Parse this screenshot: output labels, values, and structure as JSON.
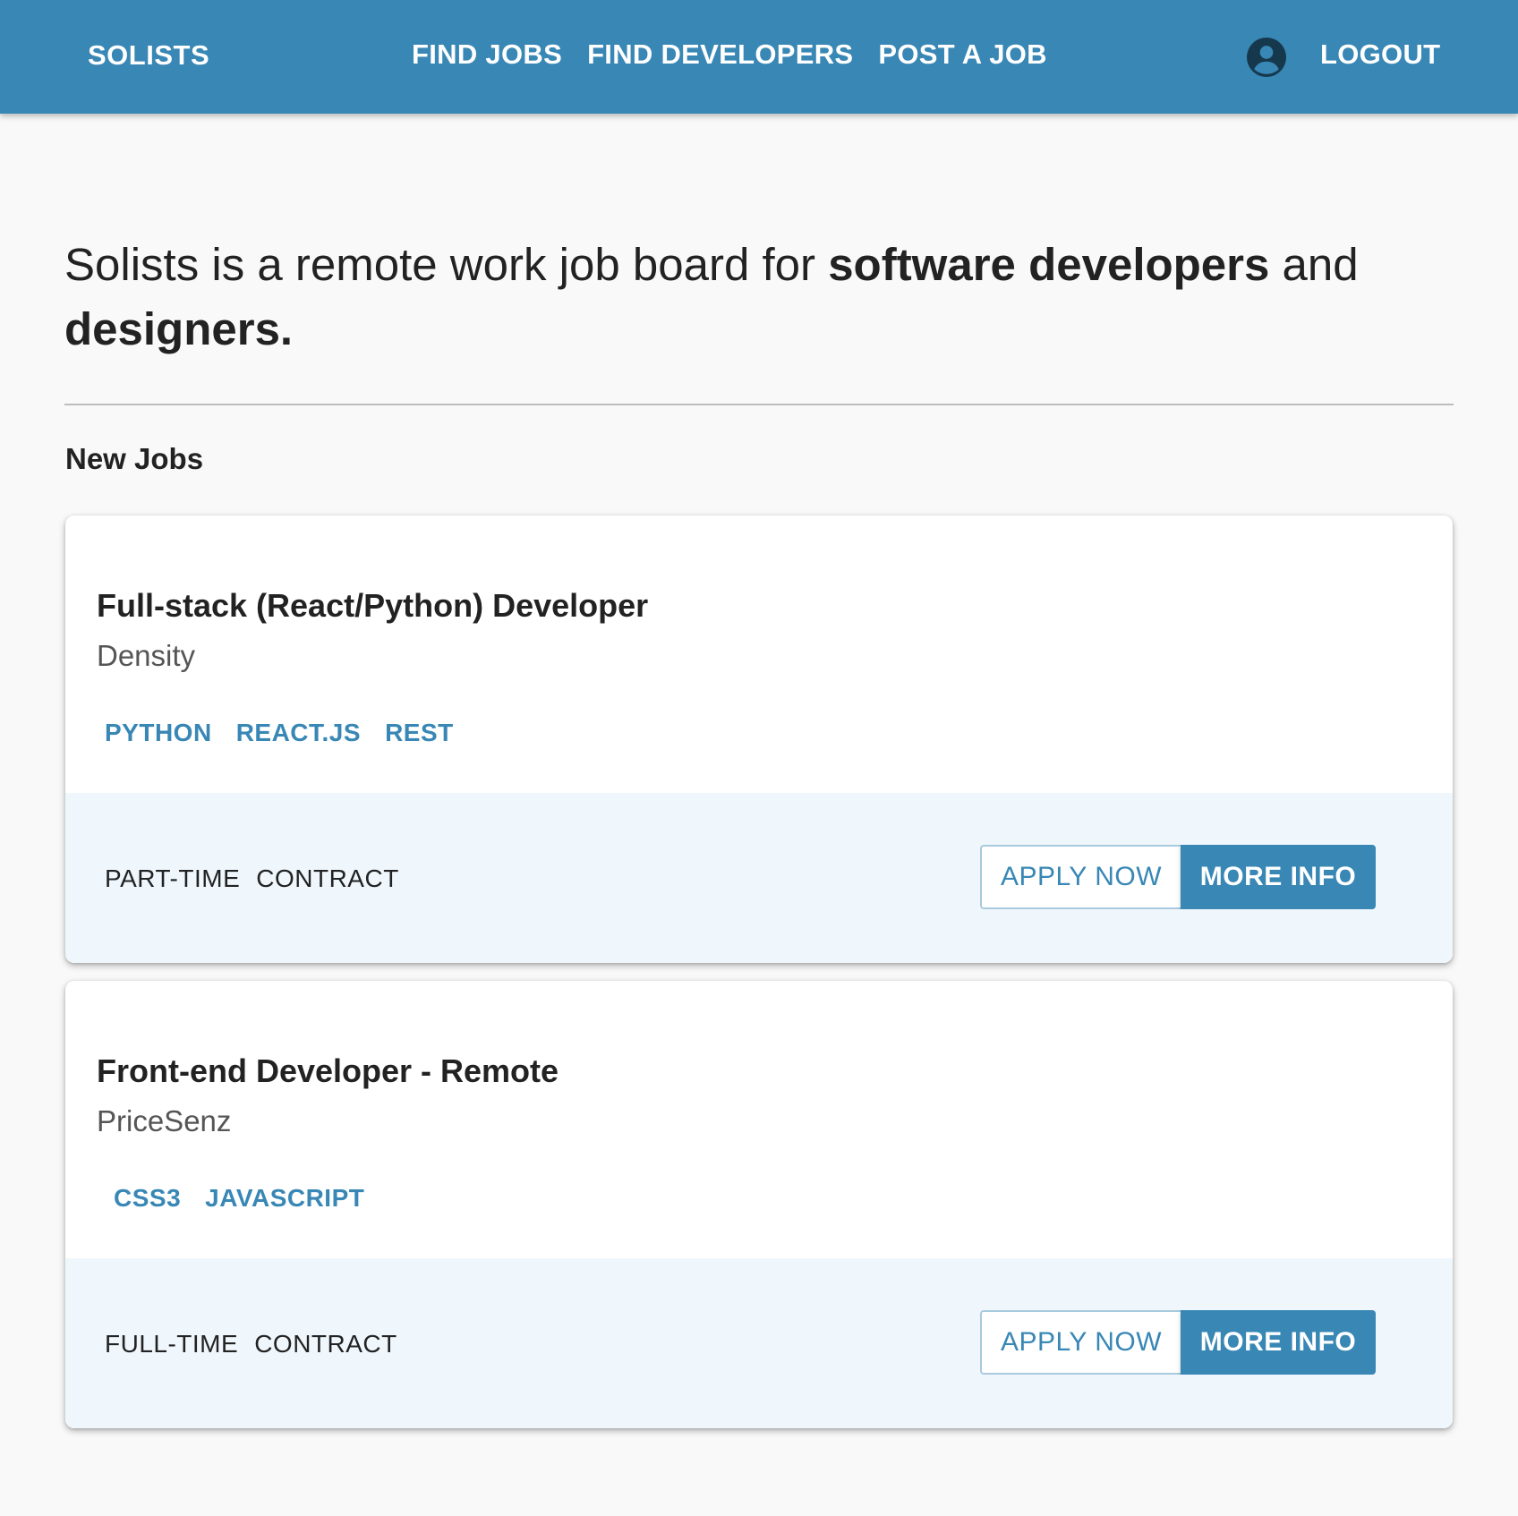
{
  "header": {
    "brand": "SOLISTS",
    "nav": [
      "FIND JOBS",
      "FIND DEVELOPERS",
      "POST A JOB"
    ],
    "logout": "LOGOUT",
    "account_icon": "account-circle-icon"
  },
  "hero": {
    "part1": "Solists is a remote work job board for ",
    "bold1": "software developers",
    "part2": " and ",
    "bold2": "designers."
  },
  "section_title": "New Jobs",
  "jobs": [
    {
      "title": "Full-stack (React/Python) Developer",
      "company": "Density",
      "tags": [
        "PYTHON",
        "REACT.JS",
        "REST"
      ],
      "types": [
        "PART-TIME",
        "CONTRACT"
      ],
      "apply": "APPLY NOW",
      "info": "MORE INFO"
    },
    {
      "title": "Front-end Developer - Remote",
      "company": "PriceSenz",
      "tags": [
        "CSS3",
        "JAVASCRIPT"
      ],
      "types": [
        "FULL-TIME",
        "CONTRACT"
      ],
      "apply": "APPLY NOW",
      "info": "MORE INFO"
    }
  ],
  "colors": {
    "primary": "#3887b5",
    "background": "#f9f9f9",
    "card_footer": "#eff7fd"
  }
}
